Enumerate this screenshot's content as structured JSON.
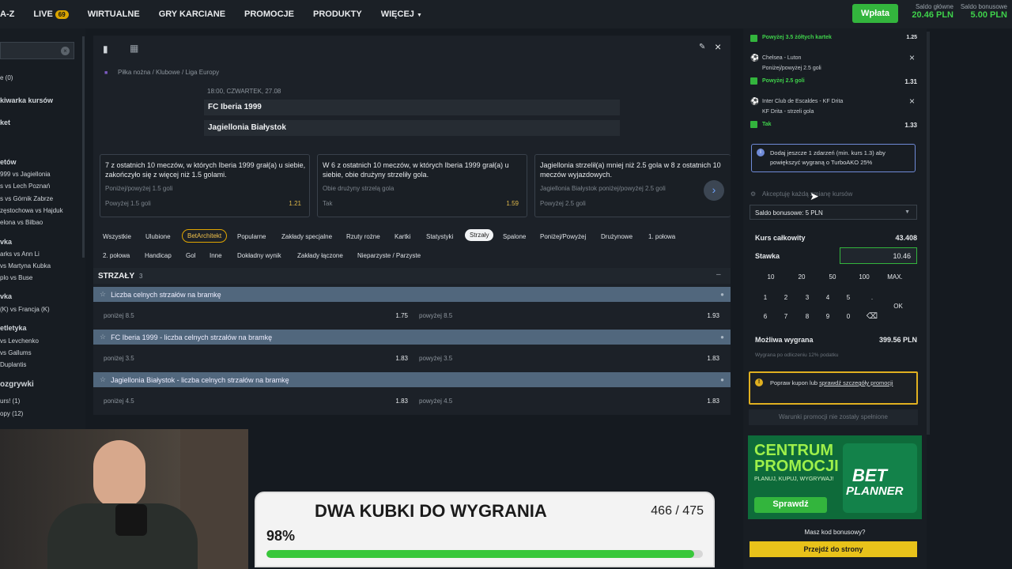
{
  "topnav": {
    "items": [
      "A-Z",
      "LIVE",
      "WIRTUALNE",
      "GRY KARCIANE",
      "PROMOCJE",
      "PRODUKTY",
      "WIĘCEJ"
    ],
    "live_badge": "69",
    "deposit_label": "Wpłata",
    "main_balance_label": "Saldo główne",
    "main_balance_value": "20.46 PLN",
    "bonus_balance_label": "Saldo bonusowe",
    "bonus_balance_value": "5.00 PLN"
  },
  "leftside": {
    "items": [
      "e (0)",
      "kiwarka kursów",
      "ket",
      "etów",
      "999 vs Jagiellonia",
      "s vs Lech Poznań",
      "s vs Górnik Zabrze",
      "zęstochowa vs Hajduk",
      "elona vs Bilbao",
      "vka",
      "arks vs Ann Li",
      "vs Martyna Kubka",
      "plo vs Buse",
      "vka",
      "(K) vs Francja (K)",
      "etletyka",
      "vs Levchenko",
      "vs Gallums",
      "Duplantis",
      "ozgrywki",
      "urs! (1)",
      "opy (12)"
    ]
  },
  "match": {
    "breadcrumb": "Piłka nożna / Klubowe / Liga Europy",
    "datetime": "18:00, CZWARTEK, 27.08",
    "team_home": "FC Iberia 1999",
    "team_away": "Jagiellonia Białystok"
  },
  "stat_cards": [
    {
      "title": "7 z ostatnich 10 meczów, w których Iberia 1999 grał(a) u siebie, zakończyło się z więcej niż 1.5 golami.",
      "sub": "Poniżej/powyżej 1.5 goli",
      "pick": "Powyżej 1.5 goli",
      "odd": "1.21"
    },
    {
      "title": "W 6 z ostatnich 10 meczów, w których Iberia 1999 grał(a) u siebie, obie drużyny strzeliły gola.",
      "sub": "Obie drużyny strzelą gola",
      "pick": "Tak",
      "odd": "1.59"
    },
    {
      "title": "Jagiellonia strzelił(a) mniej niż 2.5 gola w 8 z ostatnich 10 meczów wyjazdowych.",
      "sub": "Jagiellonia Białystok poniżej/powyżej 2.5 goli",
      "pick": "Powyżej 2.5 goli",
      "odd": ""
    }
  ],
  "tabs_row1": [
    "Wszystkie",
    "Ulubione",
    "BetArchitekt",
    "Popularne",
    "Zakłady specjalne",
    "Rzuty rożne",
    "Kartki",
    "Statystyki",
    "Strzały",
    "Spalone",
    "Poniżej/Powyżej",
    "Drużynowe",
    "1. połowa"
  ],
  "tabs_row2": [
    "2. połowa",
    "Handicap",
    "Gol",
    "Inne",
    "Dokładny wynik",
    "Zakłady łączone",
    "Nieparzyste / Parzyste"
  ],
  "section": {
    "title": "STRZAŁY",
    "count": "3",
    "collapse": "–"
  },
  "markets": [
    {
      "title": "Liczba celnych strzałów na bramkę",
      "under_label": "poniżej 8.5",
      "under_odd": "1.75",
      "over_label": "powyżej 8.5",
      "over_odd": "1.93"
    },
    {
      "title": "FC Iberia 1999 - liczba celnych strzałów na bramkę",
      "under_label": "poniżej 3.5",
      "under_odd": "1.83",
      "over_label": "powyżej 3.5",
      "over_odd": "1.83"
    },
    {
      "title": "Jagiellonia Białystok - liczba celnych strzałów na bramkę",
      "under_label": "poniżej 4.5",
      "under_odd": "1.83",
      "over_label": "powyżej 4.5",
      "over_odd": "1.83"
    }
  ],
  "betslip": {
    "sel0": {
      "pick": "Powyżej 3.5 żółtych kartek",
      "odd": "1.25"
    },
    "sel1": {
      "match": "Chelsea - Luton",
      "market": "Poniżej/powyżej 2.5 goli",
      "pick": "Powyżej 2.5 goli",
      "odd": "1.31"
    },
    "sel2": {
      "match": "Inter Club de Escaldes - KF Drita",
      "market": "KF Drita - strzeli gola",
      "pick": "Tak",
      "odd": "1.33"
    },
    "info": "Dodaj jeszcze 1 zdarzeń (min. kurs 1.3) aby powiększyć wygraną o TurboAKO 25%",
    "accept": "Akceptuję każdą zmianę kursów",
    "balance_select": "Saldo bonusowe: 5 PLN",
    "total_odds_label": "Kurs całkowity",
    "total_odds": "43.408",
    "stake_label": "Stawka",
    "stake": "10.46",
    "quick": [
      "10",
      "20",
      "50",
      "100",
      "MAX."
    ],
    "keys1": [
      "1",
      "2",
      "3",
      "4",
      "5",
      "."
    ],
    "keys2": [
      "6",
      "7",
      "8",
      "9",
      "0",
      "⌫"
    ],
    "ok": "OK",
    "win_label": "Możliwa wygrana",
    "win_value": "399.56 PLN",
    "tax_note": "Wygrana po odliczeniu 12% podatku",
    "warn": "Popraw kupon lub",
    "warn_link": "sprawdź szczegóły promocji",
    "promo_unmet": "Warunki promocji nie zostały spełnione"
  },
  "promo": {
    "title1": "CENTRUM",
    "title2": "PROMOCJI",
    "tag": "PLANUJ, KUPUJ, WYGRYWAJ!",
    "btn": "Sprawdź",
    "logo1": "BET",
    "logo2": "PLANNER",
    "code_q": "Masz kod bonusowy?",
    "go": "Przejdź do strony"
  },
  "goal": {
    "title": "DWA KUBKI DO WYGRANIA",
    "count": "466 / 475",
    "percent": "98%",
    "progress": 0.98
  },
  "colors": {
    "accent_green": "#33b53d",
    "odd_yellow": "#e0b94a",
    "market_header": "#51677d"
  }
}
